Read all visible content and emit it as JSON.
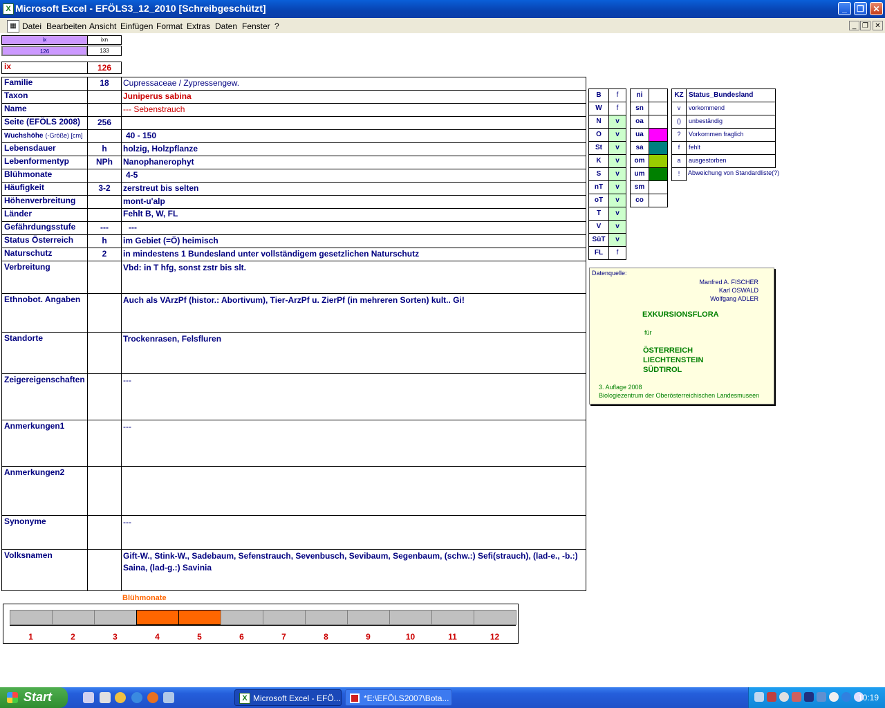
{
  "window": {
    "title": "Microsoft Excel - EFÖLS3_12_2010  [Schreibgeschützt]"
  },
  "menu": [
    "Datei",
    "Bearbeiten",
    "Ansicht",
    "Einfügen",
    "Format",
    "Extras",
    "Daten",
    "Fenster",
    "?"
  ],
  "nav": {
    "ix_label": "ix",
    "ixn_label": "ixn",
    "ix_value": "126",
    "ixn_value": "133",
    "ix_big_label": "ix",
    "ix_big_value": "126"
  },
  "rows": [
    {
      "label": "Familie",
      "code": "18",
      "value": "Cupressaceae  /  Zypressengew."
    },
    {
      "label": "Taxon",
      "code": "",
      "value": "Juniperus sabina"
    },
    {
      "label": "Name",
      "code": "",
      "value": "--- Sebenstrauch"
    },
    {
      "label": "Seite (EFÖLS 2008)",
      "code": "256",
      "value": ""
    },
    {
      "label": "Wuchshöhe",
      "label_suffix": "(-Größe) [cm]",
      "code": "",
      "value": "40 - 150"
    },
    {
      "label": "Lebensdauer",
      "code": "h",
      "value": "holzig, Holzpflanze"
    },
    {
      "label": "Lebenformentyp",
      "code": "NPh",
      "value": "Nanophanerophyt"
    },
    {
      "label": "Blühmonate",
      "code": "",
      "value": "4-5"
    },
    {
      "label": "Häufigkeit",
      "code": "3-2",
      "value": "zerstreut bis selten"
    },
    {
      "label": "Höhenverbreitung",
      "code": "",
      "value": "mont-u'alp"
    },
    {
      "label": "Länder",
      "code": "",
      "value": "Fehlt B, W, FL"
    },
    {
      "label": "Gefährdungsstufe",
      "code": "---",
      "value": "---"
    },
    {
      "label": "Status Österreich",
      "code": "h",
      "value": "im Gebiet (=Ö) heimisch"
    },
    {
      "label": "Naturschutz",
      "code": "2",
      "value": "in mindestens 1 Bundesland unter vollständigem gesetzlichen Naturschutz"
    }
  ],
  "blocks": [
    {
      "label": "Verbreitung",
      "value": "Vbd: in T hfg, sonst zstr bis slt."
    },
    {
      "label": "Ethnobot. Angaben",
      "value": "Auch als VArzPf (histor.: Abortivum), Tier-ArzPf u. ZierPf (in mehreren Sorten) kult.. Gi!"
    },
    {
      "label": "Standorte",
      "value": "Trockenrasen, Felsfluren"
    },
    {
      "label": "Zeigereigenschaften",
      "value": "---"
    },
    {
      "label": "Anmerkungen1",
      "value": "---"
    },
    {
      "label": "Anmerkungen2",
      "value": ""
    },
    {
      "label": "Synonyme",
      "value": "---"
    },
    {
      "label": "Volksnamen",
      "value": "Gift-W., Stink-W., Sadebaum, Sefenstrauch, Sevenbusch, Sevibaum,  Segenbaum, (schw.:) Sefi(strauch), (lad-e., -b.:)",
      "value2": "Saina, (lad-g.:) Savinia"
    }
  ],
  "states": [
    {
      "code": "B",
      "v": "f"
    },
    {
      "code": "W",
      "v": "f"
    },
    {
      "code": "N",
      "v": "v"
    },
    {
      "code": "O",
      "v": "v"
    },
    {
      "code": "St",
      "v": "v"
    },
    {
      "code": "K",
      "v": "v"
    },
    {
      "code": "S",
      "v": "v"
    },
    {
      "code": "nT",
      "v": "v"
    },
    {
      "code": "oT",
      "v": "v"
    },
    {
      "code": "T",
      "v": "v"
    },
    {
      "code": "V",
      "v": "v"
    },
    {
      "code": "SüT",
      "v": "v"
    },
    {
      "code": "FL",
      "v": "f"
    }
  ],
  "zones": [
    {
      "code": "ni",
      "color": "#ffffff"
    },
    {
      "code": "sn",
      "color": "#ffffff"
    },
    {
      "code": "oa",
      "color": "#ffffff"
    },
    {
      "code": "ua",
      "color": "#ff00ff"
    },
    {
      "code": "sa",
      "color": "#008080"
    },
    {
      "code": "om",
      "color": "#99cc00"
    },
    {
      "code": "um",
      "color": "#008000"
    },
    {
      "code": "sm",
      "color": "#ffffff"
    },
    {
      "code": "co",
      "color": "#ffffff"
    }
  ],
  "legend": {
    "kz_header": "KZ",
    "status_header": "Status_Bundesland",
    "items": [
      {
        "kz": "v",
        "text": "vorkommend"
      },
      {
        "kz": "()",
        "text": "unbeständig"
      },
      {
        "kz": "?",
        "text": "Vorkommen fraglich"
      },
      {
        "kz": "f",
        "text": "fehlt"
      },
      {
        "kz": "a",
        "text": "ausgestorben"
      },
      {
        "kz": "!",
        "text": "Abweichung von Standardliste(?)"
      }
    ]
  },
  "source": {
    "label": "Datenquelle:",
    "authors": [
      "Manfred A. FISCHER",
      "Karl OSWALD",
      "Wolfgang ADLER"
    ],
    "title": "EXKURSIONSFLORA",
    "fuer": "für",
    "countries": [
      "ÖSTERREICH",
      "LIECHTENSTEIN",
      "SÜDTIROL"
    ],
    "edition": "3. Auflage 2008",
    "publisher": "Biologiezentrum der Oberösterreichischen Landesmuseen"
  },
  "bloom": {
    "title": "Blühmonate",
    "months": [
      "1",
      "2",
      "3",
      "4",
      "5",
      "6",
      "7",
      "8",
      "9",
      "10",
      "11",
      "12"
    ],
    "active": [
      4,
      5
    ]
  },
  "taskbar": {
    "start": "Start",
    "buttons": [
      "Microsoft Excel - EFÖ...",
      "*E:\\EFÖLS2007\\Bota..."
    ],
    "clock": "10:19"
  }
}
